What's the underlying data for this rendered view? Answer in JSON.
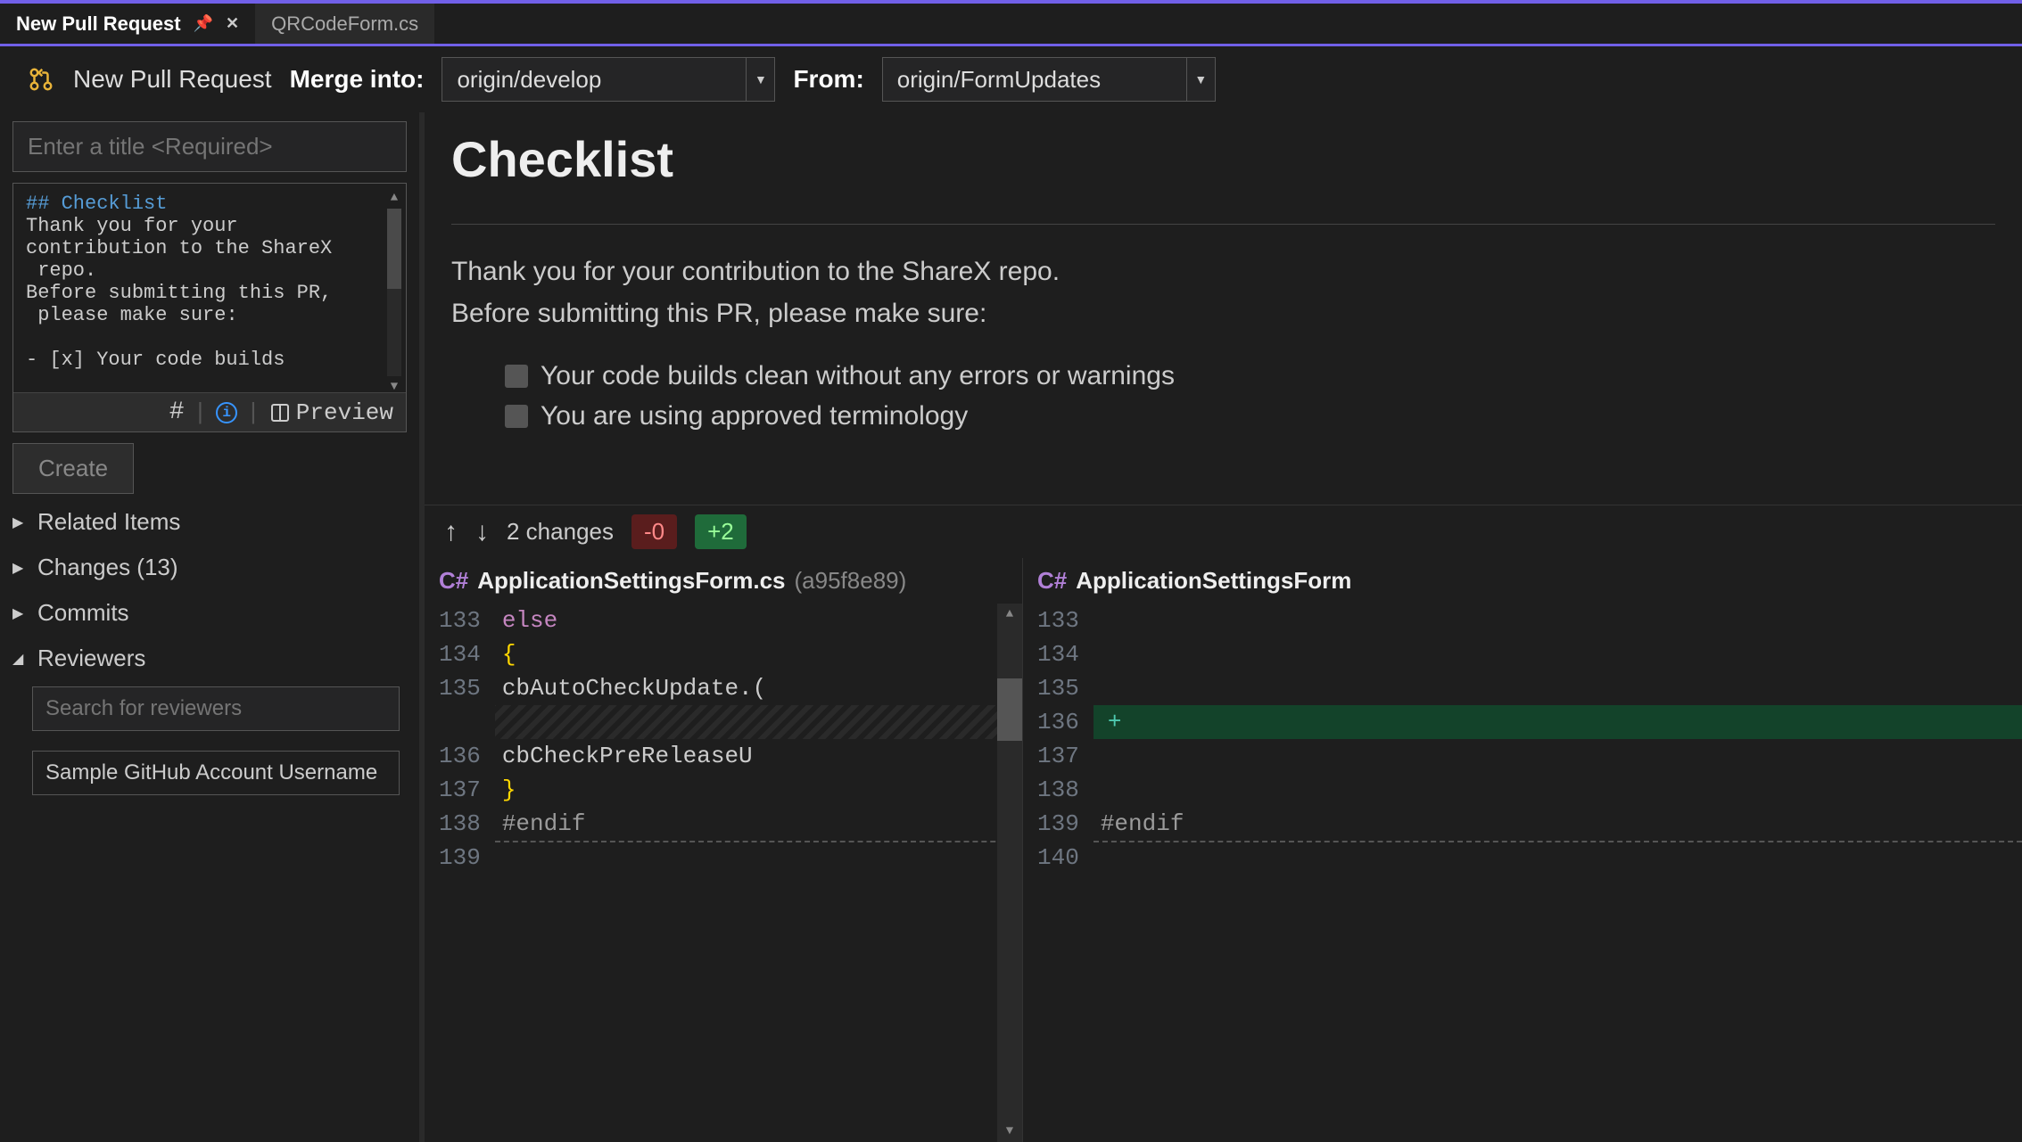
{
  "tabs": [
    {
      "label": "New Pull Request",
      "active": true
    },
    {
      "label": "QRCodeForm.cs",
      "active": false
    }
  ],
  "toolbar": {
    "title": "New Pull Request",
    "merge_into_label": "Merge into:",
    "merge_into_value": "origin/develop",
    "from_label": "From:",
    "from_value": "origin/FormUpdates"
  },
  "pr_form": {
    "title_placeholder": "Enter a title <Required>",
    "description_text": "## Checklist\nThank you for your\ncontribution to the ShareX\n repo.\nBefore submitting this PR,\n please make sure:\n\n- [x] Your code builds",
    "preview_label": "Preview",
    "create_label": "Create"
  },
  "tree": {
    "related_items": "Related Items",
    "changes": "Changes (13)",
    "commits": "Commits",
    "reviewers": "Reviewers",
    "reviewer_search_placeholder": "Search for reviewers",
    "reviewer_sample": "Sample GitHub Account Username"
  },
  "preview": {
    "heading": "Checklist",
    "body1": "Thank you for your contribution to the ShareX repo.",
    "body2": "Before submitting this PR, please make sure:",
    "item1": "Your code builds clean without any errors or warnings",
    "item2": "You are using approved terminology"
  },
  "diff": {
    "changes_text": "2 changes",
    "minus": "-0",
    "plus": "+2",
    "file_left": {
      "lang": "C#",
      "name": "ApplicationSettingsForm.cs",
      "hash": "(a95f8e89)"
    },
    "file_right": {
      "lang": "C#",
      "name": "ApplicationSettingsForm"
    },
    "left_lines": {
      "nums": [
        "133",
        "134",
        "135",
        "",
        "136",
        "137",
        "138",
        "139"
      ],
      "l133": "else",
      "l134": "{",
      "l135": "cbAutoCheckUpdate.(",
      "l136": "cbCheckPreReleaseU",
      "l137": "}",
      "l138": "#endif",
      "l139": ""
    },
    "right_lines": {
      "nums": [
        "133",
        "134",
        "135",
        "136",
        "137",
        "138",
        "139",
        "140"
      ],
      "l136_plus": "+",
      "l139": "#endif"
    }
  }
}
